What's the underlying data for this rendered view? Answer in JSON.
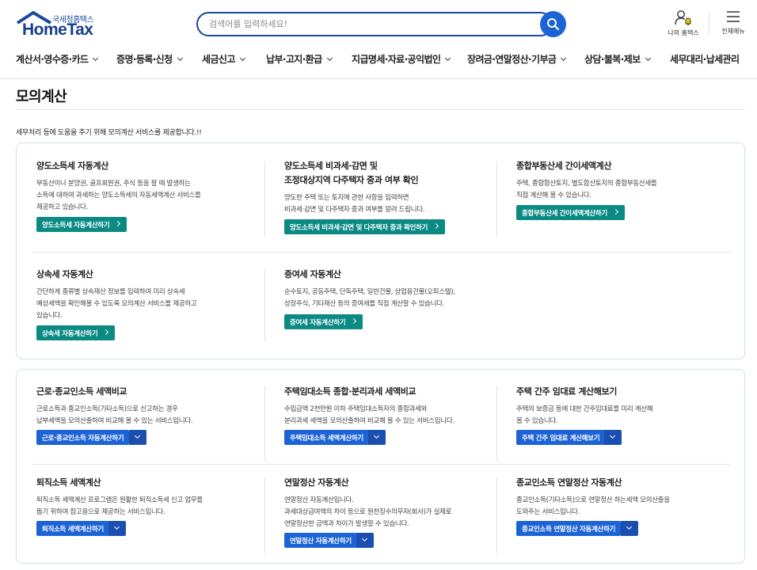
{
  "header": {
    "logo_sub": "국세청홈택스",
    "logo_main": "HomeTax",
    "search_placeholder": "검색어를 입력하세요!",
    "my_hometax": "나의 홈택스",
    "all_menu": "전체메뉴"
  },
  "gnb": [
    "계산서·영수증·카드",
    "증명·등록·신청",
    "세금신고",
    "납부·고지·환급",
    "지급명세·자료·공익법인",
    "장려금·연말정산·기부금",
    "상담·불복·제보",
    "세무대리·납세관리"
  ],
  "page": {
    "title": "모의계산",
    "intro": "세무처리 등에 도움을 주기 위해 모의계산 서비스를 제공합니다.!!"
  },
  "group1": [
    {
      "title": "양도소득세 자동계산",
      "desc": [
        "부동산이나 분양권, 골프회원권, 주식 등을 팔 때 발생하는",
        "소득에 대하여 과세하는 양도소득세의 자동세액계산 서비스를",
        "제공하고 있습니다."
      ],
      "button": "양도소득세 자동계산하기"
    },
    {
      "title": "양도소득세 비과세·감면 및\n조정대상지역 다주택자 중과 여부 확인",
      "desc": [
        "양도한 주택 또는 토지에 관한 사항을 입력하면",
        "비과세·감면 및 다주택자 중과 여부를 알려 드립니다."
      ],
      "button": "양도소득세 비과세·감면 및 다주택자 중과 확인하기"
    },
    {
      "title": "종합부동산세 간이세액계산",
      "desc": [
        "주택, 종합합산토지, 별도합산토지의 종합부동산세를",
        "직접 계산해 볼 수 있습니다."
      ],
      "button": "종합부동산세 간이세액계산하기"
    },
    {
      "title": "상속세 자동계산",
      "desc": [
        "간단하게 종류별 상속재산 정보를 입력하여 미리 상속세",
        "예상세액을 확인해볼 수 있도록 모의계산 서비스를 제공하고",
        "있습니다."
      ],
      "button": "상속세 자동계산하기"
    },
    {
      "title": "증여세 자동계산",
      "desc": [
        "순수토지, 공동주택, 단독주택, 일반건물, 상업용건물(오피스텔),",
        "상장주식, 기타재산 등의 증여세를 직접 계산할 수 있습니다."
      ],
      "button": "증여세 자동계산하기"
    }
  ],
  "group2": [
    {
      "title": "근로·종교인소득 세액비교",
      "desc": [
        "근로소득과 종교인소득(기타소득)으로 신고하는 경우",
        "납부세액을 모의산출하여 비교해 볼 수 있는 서비스입니다."
      ],
      "button": "근로·종교인소득 자동계산하기"
    },
    {
      "title": "주택임대소득 종합·분리과세 세액비교",
      "desc": [
        "수입금액 2천만원 이하 주택임대소득자의 종합과세와",
        "분리과세 세액을 모의산출하여 비교해 볼 수 있는 서비스입니다."
      ],
      "button": "주택임대소득 세액계산하기"
    },
    {
      "title": "주택 간주 임대료 계산해보기",
      "desc": [
        "주택의 보증금 등에 대한 간주임대료를 미리 계산해",
        "볼 수 있습니다."
      ],
      "button": "주택 간주 임대료 계산해보기"
    },
    {
      "title": "퇴직소득 세액계산",
      "desc": [
        "퇴직소득 세액계산 프로그램은 원활한 퇴직소득세 신고 업무를",
        "돕기 위하여 참고용으로 제공하는 서비스입니다."
      ],
      "button": "퇴직소득 세액계산하기"
    },
    {
      "title": "연말정산 자동계산",
      "desc": [
        "연말정산 자동계산입니다.",
        "과세대상급여액의 차이 등으로 원천징수의무자(회사)가 실제로",
        "연말정산한 금액과 차이가 발생할 수 있습니다."
      ],
      "button": "연말정산 자동계산하기"
    },
    {
      "title": "종교인소득 연말정산 자동계산",
      "desc": [
        "종교인소득(기타소득)으로 연말정산 하는세액 모의산출을",
        "도와주는 서비스입니다."
      ],
      "button": "종교인소득 연말정산 자동계산하기"
    }
  ],
  "colors": {
    "brand": "#1b4a9c",
    "teal": "#0a8a83",
    "blue": "#1d63d6"
  }
}
